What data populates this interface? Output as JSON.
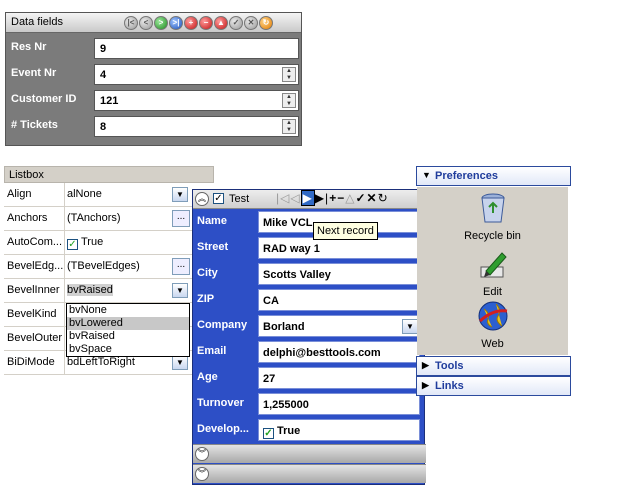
{
  "data_fields": {
    "title": "Data fields",
    "rows": [
      {
        "label": "Res Nr",
        "value": "9"
      },
      {
        "label": "Event Nr",
        "value": "4"
      },
      {
        "label": "Customer ID",
        "value": "121"
      },
      {
        "label": "# Tickets",
        "value": "8"
      }
    ]
  },
  "listbox": {
    "title": "Listbox",
    "rows": [
      {
        "key": "Align",
        "value": "alNone"
      },
      {
        "key": "Anchors",
        "value": "(TAnchors)"
      },
      {
        "key": "AutoCom...",
        "value": "True"
      },
      {
        "key": "BevelEdg...",
        "value": "(TBevelEdges)"
      },
      {
        "key": "BevelInner",
        "value": "bvRaised"
      },
      {
        "key": "BevelKind",
        "value": ""
      },
      {
        "key": "BevelOuter",
        "value": ""
      },
      {
        "key": "BiDiMode",
        "value": "bdLeftToRight"
      }
    ],
    "dropdown": [
      "bvNone",
      "bvLowered",
      "bvRaised",
      "bvSpace"
    ]
  },
  "record_form": {
    "title": "Test",
    "tooltip": "Next record",
    "rows": [
      {
        "label": "Name",
        "value": "Mike VCL"
      },
      {
        "label": "Street",
        "value": "RAD way 1"
      },
      {
        "label": "City",
        "value": "Scotts Valley"
      },
      {
        "label": "ZIP",
        "value": "CA"
      },
      {
        "label": "Company",
        "value": "Borland"
      },
      {
        "label": "Email",
        "value": "delphi@besttools.com"
      },
      {
        "label": "Age",
        "value": "27"
      },
      {
        "label": "Turnover",
        "value": "1,255000"
      },
      {
        "label": "Develop...",
        "value": "True"
      }
    ]
  },
  "outlook_panel": {
    "groups": [
      "Preferences",
      "Tools",
      "Links"
    ],
    "items": [
      {
        "label": "Recycle bin",
        "icon": "recycle-bin-icon"
      },
      {
        "label": "Edit",
        "icon": "edit-icon"
      },
      {
        "label": "Web",
        "icon": "globe-icon"
      }
    ]
  }
}
